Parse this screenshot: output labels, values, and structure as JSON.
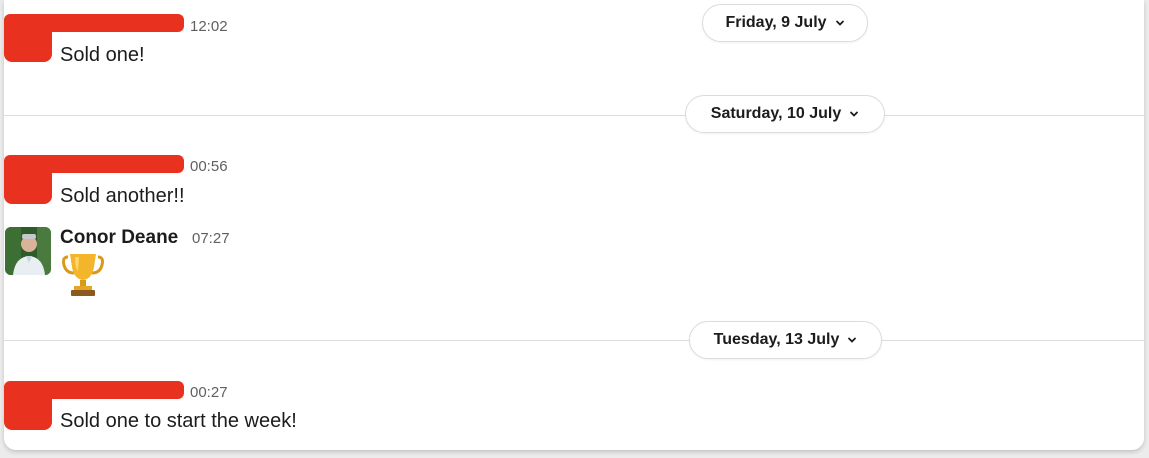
{
  "dates": [
    {
      "label": "Friday, 9 July"
    },
    {
      "label": "Saturday, 10 July"
    },
    {
      "label": "Tuesday, 13 July"
    }
  ],
  "messages": [
    {
      "time": "12:02",
      "text": "Sold one!"
    },
    {
      "time": "00:56",
      "text": "Sold another!!"
    },
    {
      "sender": "Conor Deane",
      "time": "07:27",
      "emoji": "trophy-icon"
    },
    {
      "time": "00:27",
      "text": "Sold one to start the week!"
    }
  ],
  "colors": {
    "redaction": "#e8321f",
    "divider": "#dddddd",
    "timestamp": "#616061"
  }
}
